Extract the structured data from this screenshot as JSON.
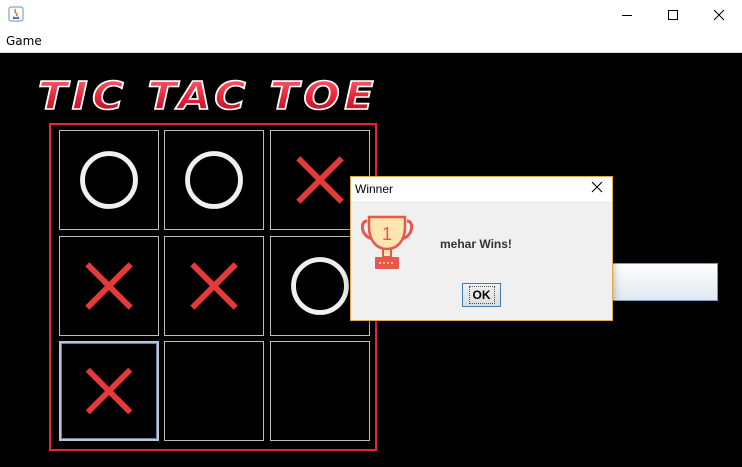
{
  "window": {
    "icon": "java-icon",
    "controls": [
      "minimize-icon",
      "maximize-icon",
      "close-icon"
    ]
  },
  "menubar": {
    "items": [
      {
        "label": "Game"
      }
    ]
  },
  "game": {
    "logo_text": "TIC TAC TOE",
    "logo_color": "#e8263a",
    "board_border_color": "#e8262d",
    "mark_x_color": "#e63a3a",
    "mark_o_color": "#f0f0f0",
    "cells": [
      "O",
      "O",
      "X",
      "X",
      "X",
      "O",
      "X",
      "",
      ""
    ],
    "focused_cell": 6
  },
  "dialog": {
    "title": "Winner",
    "message": "mehar Wins!",
    "ok_label": "OK",
    "trophy_number": "1",
    "trophy_color": "#e8574c",
    "trophy_light": "#ffe6b0"
  }
}
